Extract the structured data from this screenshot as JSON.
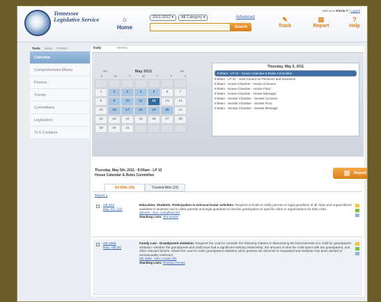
{
  "header": {
    "logo_text": "Tennessee Legislative Service",
    "home_label": "Home",
    "filter_year": "2011-2012",
    "filter_category": "All Category",
    "advanced_link": "Advanced",
    "search_placeholder": "",
    "search_label": "Search",
    "nav": [
      {
        "label": "Track",
        "icon": "pencil-icon"
      },
      {
        "label": "Report",
        "icon": "report-icon"
      },
      {
        "label": "Help",
        "icon": "help-icon"
      }
    ],
    "welcome_text": "Welcome",
    "user_name": "Kerrie T",
    "logout_label": "Logout"
  },
  "sidebar": {
    "tabs": [
      "Tools",
      "Notes",
      "Printers"
    ],
    "items": [
      "Calendar",
      "Comprehensive Memo",
      "Proxies",
      "Trends",
      "Committees",
      "Legislators",
      "TLS Contacts"
    ]
  },
  "main": {
    "view_tabs": [
      "Daily",
      "Weekly"
    ],
    "calendar": {
      "prev": "<<",
      "month": "May",
      "year": "2011",
      "next": ">>",
      "dows": [
        "S",
        "M",
        "T",
        "W",
        "T",
        "F",
        "S"
      ],
      "days": [
        {
          "d": "",
          "s": "dim"
        },
        {
          "d": "",
          "s": "dim"
        },
        {
          "d": "",
          "s": "dim"
        },
        {
          "d": "",
          "s": "dim"
        },
        {
          "d": "",
          "s": "dim"
        },
        {
          "d": "",
          "s": "dim"
        },
        {
          "d": "",
          "s": "dim"
        },
        {
          "d": "1",
          "s": ""
        },
        {
          "d": "2",
          "s": "hl"
        },
        {
          "d": "3",
          "s": "hl"
        },
        {
          "d": "4",
          "s": "hl"
        },
        {
          "d": "5",
          "s": "hl"
        },
        {
          "d": "6",
          "s": ""
        },
        {
          "d": "7",
          "s": ""
        },
        {
          "d": "8",
          "s": ""
        },
        {
          "d": "9",
          "s": "hl"
        },
        {
          "d": "10",
          "s": "hl"
        },
        {
          "d": "11",
          "s": "hl"
        },
        {
          "d": "12",
          "s": "today"
        },
        {
          "d": "13",
          "s": ""
        },
        {
          "d": "14",
          "s": ""
        },
        {
          "d": "15",
          "s": ""
        },
        {
          "d": "16",
          "s": "hl"
        },
        {
          "d": "17",
          "s": "hl"
        },
        {
          "d": "18",
          "s": "hl"
        },
        {
          "d": "19",
          "s": "hl"
        },
        {
          "d": "20",
          "s": "hl"
        },
        {
          "d": "21",
          "s": ""
        },
        {
          "d": "22",
          "s": ""
        },
        {
          "d": "23",
          "s": ""
        },
        {
          "d": "24",
          "s": ""
        },
        {
          "d": "25",
          "s": ""
        },
        {
          "d": "26",
          "s": ""
        },
        {
          "d": "27",
          "s": ""
        },
        {
          "d": "28",
          "s": ""
        },
        {
          "d": "29",
          "s": ""
        },
        {
          "d": "30",
          "s": ""
        },
        {
          "d": "31",
          "s": ""
        },
        {
          "d": "",
          "s": "dim"
        },
        {
          "d": "",
          "s": "dim"
        },
        {
          "d": "",
          "s": "dim"
        },
        {
          "d": "",
          "s": "dim"
        }
      ]
    },
    "day_title": "Thursday, May 5, 2011",
    "events": [
      "8:00am - LP 12 - House Calendar & Rules Committee",
      "8:00am - LP 31 - Joint Council on Pensions and Insurance",
      "8:30am - House Chamber - House Convene",
      "9:00am - House Chamber - House Floor",
      "9:00am - House Chamber - House Message",
      "9:00am - Senate Chamber - Senate Convene",
      "9:00am - Senate Chamber - Senate Floor",
      "9:00am - Senate Chamber - Senate Message"
    ],
    "details_line1": "Thursday, May 5th, 2011 - 8:00am - LP 12",
    "details_line2": "House Calendar & Rules Committee",
    "report_label": "Report",
    "bill_tabs": [
      "All Bills (16)",
      "Tracked Bills (16)"
    ],
    "sub_link": "Report 1",
    "bills": [
      {
        "num": "HB 622",
        "sponsor": "Maj. Rd. (12)",
        "title": "Education, Students: Participation in extracurricular activities.",
        "summary": "Requires schools to notify parents or legal guardians of all clubs and organizations available to students and to allow parents and legal guardians to decline participation in specific clubs or organizations for their child.",
        "links": "SB 622 - Sen. Campfield (R)",
        "stacking_label": "Stacking Lists:",
        "stacking_value": "Tennessee"
      },
      {
        "num": "HB 3306",
        "sponsor": "Rep. Hill (R)",
        "title": "Family Law - Grandparent visitation.",
        "summary": "Requires the court to consider the following matters in determining the best interests of a child for grandparent visitation: whether the grandparent and child have had a significant existing relationship, the amount of time the child spent with the grandparent, and other relevant factors. Allows the court to order grandparent visitation when parents are divorced or separated and visitation has been denied or unreasonably restricted.",
        "links": "SB 3305 - Sen. Crowe (R)",
        "stacking_label": "Stacking Lists:",
        "stacking_value": "Nursing Homes"
      }
    ],
    "flag_colors": [
      "#f3c43a",
      "#7cc04a",
      "#8fb3dc"
    ]
  }
}
